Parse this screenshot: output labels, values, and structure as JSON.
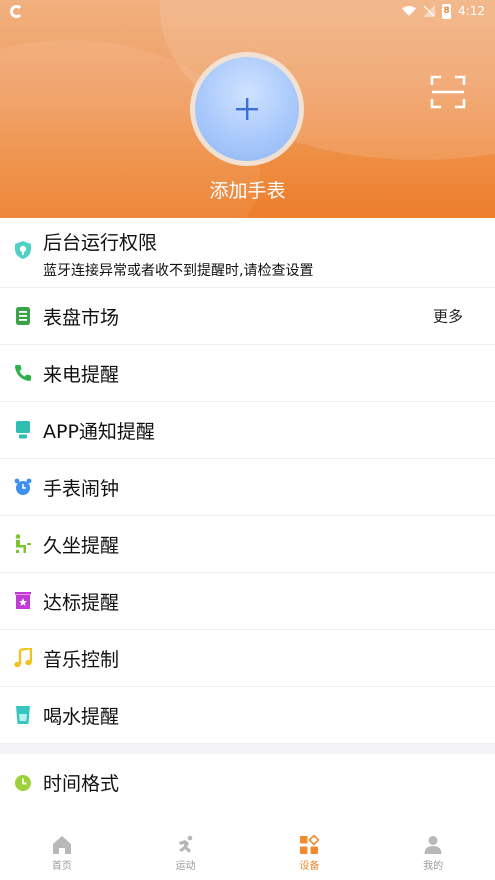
{
  "status_bar": {
    "time": "4:12",
    "battery": "8"
  },
  "header": {
    "add_watch_label": "添加手表"
  },
  "permission": {
    "title": "后台运行权限",
    "subtitle": "蓝牙连接异常或者收不到提醒时,请检查设置"
  },
  "menu": [
    {
      "label": "表盘市场",
      "more": "更多",
      "icon": "watch-face-icon",
      "color": "#3aa34a"
    },
    {
      "label": "来电提醒",
      "icon": "phone-icon",
      "color": "#2cb24a"
    },
    {
      "label": "APP通知提醒",
      "icon": "notification-icon",
      "color": "#2fbfb0"
    },
    {
      "label": "手表闹钟",
      "icon": "alarm-icon",
      "color": "#3d8ff0"
    },
    {
      "label": "久坐提醒",
      "icon": "sedentary-icon",
      "color": "#7cc52f"
    },
    {
      "label": "达标提醒",
      "icon": "goal-icon",
      "color": "#c03ad6"
    },
    {
      "label": "音乐控制",
      "icon": "music-icon",
      "color": "#f0c21e"
    },
    {
      "label": "喝水提醒",
      "icon": "water-icon",
      "color": "#38c7c0"
    }
  ],
  "menu2": [
    {
      "label": "时间格式",
      "icon": "clock-icon",
      "color": "#9bd23a"
    }
  ],
  "tabs": [
    {
      "label": "首页",
      "icon": "home-icon",
      "active": false
    },
    {
      "label": "运动",
      "icon": "run-icon",
      "active": false
    },
    {
      "label": "设备",
      "icon": "device-icon",
      "active": true
    },
    {
      "label": "我的",
      "icon": "profile-icon",
      "active": false
    }
  ],
  "colors": {
    "header_orange": "#ee8c40",
    "active_tab": "#f08a2e",
    "add_plus": "#3a6fd8"
  }
}
